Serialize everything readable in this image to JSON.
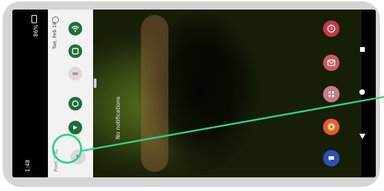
{
  "status_bar": {
    "time": "1:48",
    "battery": "86%"
  },
  "quick_settings": {
    "date_label": "Tue, Feb 18",
    "bottom_label": "Pixel 3 XL",
    "tiles": [
      {
        "name": "wifi-tile",
        "icon": "wifi-icon",
        "state": "on"
      },
      {
        "name": "bluetooth-tile",
        "icon": "bluetooth-icon",
        "state": "on"
      },
      {
        "name": "dnd-tile",
        "icon": "do-not-disturb-icon",
        "state": "off"
      },
      {
        "name": "flashlight-tile",
        "icon": "flashlight-icon",
        "state": "on"
      },
      {
        "name": "autorotate-tile",
        "icon": "rotate-icon",
        "state": "on"
      },
      {
        "name": "battery-saver-tile",
        "icon": "play-icon",
        "state": "off"
      }
    ]
  },
  "notifications": {
    "empty_text": "No notifications"
  },
  "home": {
    "apps": [
      {
        "name": "clock-app",
        "icon": "clock-icon",
        "color": "#c4394a"
      },
      {
        "name": "gmail-app",
        "icon": "mail-icon",
        "color": "#c95b64"
      },
      {
        "name": "photos-app",
        "icon": "grid-icon",
        "color": "#c47f86"
      },
      {
        "name": "chrome-app",
        "icon": "chrome-icon",
        "color": "#e65a3d"
      },
      {
        "name": "messages-app",
        "icon": "message-icon",
        "color": "#2d4fb8"
      }
    ]
  },
  "colors": {
    "tile_on": "#1f6e3a",
    "tile_off": "#e0d7d7",
    "highlight": "#30d28a",
    "frame": "#d5d5d5"
  }
}
